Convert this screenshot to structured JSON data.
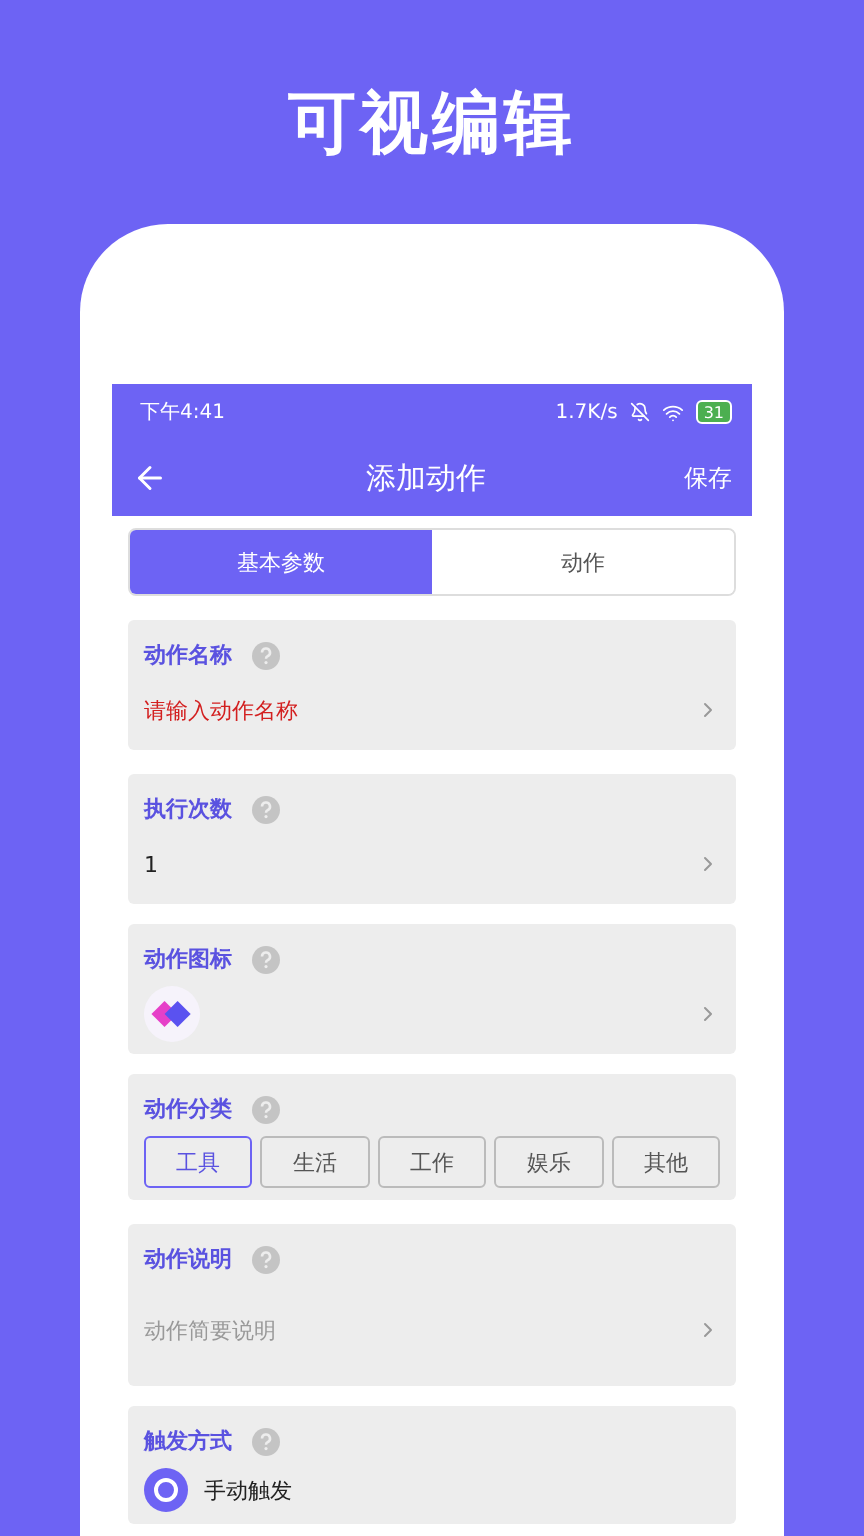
{
  "headline": "可视编辑",
  "status_bar": {
    "time": "下午4:41",
    "speed": "1.7K/s",
    "battery": "31"
  },
  "app_bar": {
    "title": "添加动作",
    "action": "保存"
  },
  "tabs": [
    {
      "label": "基本参数",
      "selected": true
    },
    {
      "label": "动作",
      "selected": false
    }
  ],
  "fields": [
    {
      "kind": "select",
      "label": "动作名称",
      "value": "请输入动作名称",
      "invalid": true
    },
    {
      "kind": "select",
      "label": "执行次数",
      "value": "1",
      "invalid": false
    },
    {
      "kind": "icon",
      "label": "动作图标"
    },
    {
      "kind": "chips",
      "label": "动作分类",
      "options": [
        {
          "label": "工具",
          "selected": true
        },
        {
          "label": "生活",
          "selected": false
        },
        {
          "label": "工作",
          "selected": false
        },
        {
          "label": "娱乐",
          "selected": false
        },
        {
          "label": "其他",
          "selected": false
        }
      ]
    },
    {
      "kind": "select",
      "label": "动作说明",
      "placeholder": "动作简要说明"
    },
    {
      "kind": "option",
      "label": "触发方式",
      "value": "手动触发"
    }
  ]
}
